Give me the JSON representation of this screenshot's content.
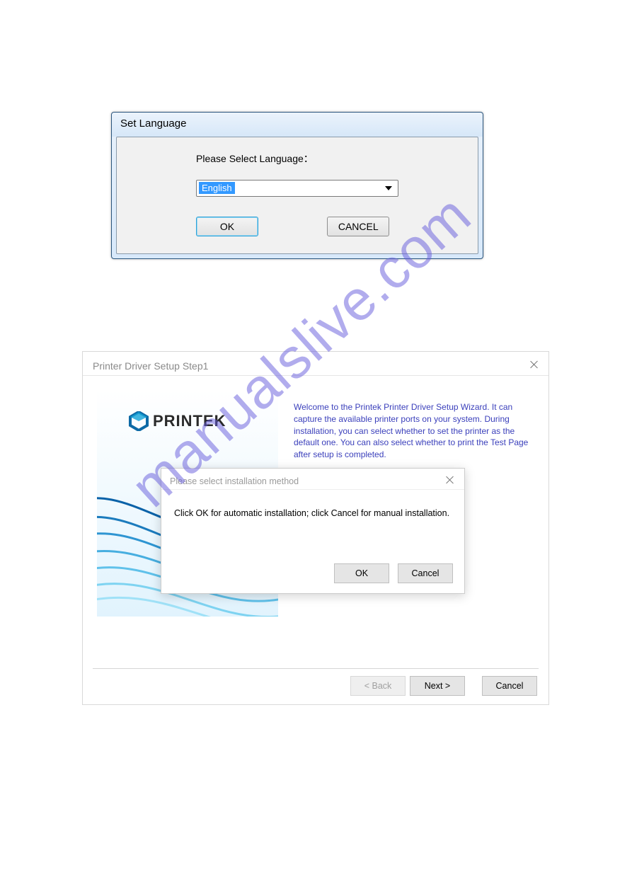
{
  "watermark": "manualslive.com",
  "dialog1": {
    "title": "Set Language",
    "label": "Please Select Language：",
    "selected": "English",
    "ok": "OK",
    "cancel": "CANCEL"
  },
  "dialog2": {
    "title": "Printer Driver Setup Step1",
    "brand": "PRINTEK",
    "welcome": "Welcome to the Printek Printer Driver Setup Wizard. It can capture the available printer ports on your system. During installation, you can select whether to set the printer as the default one. You can also select whether to print the Test Page after setup is completed.",
    "back": "< Back",
    "next": "Next >",
    "cancel": "Cancel"
  },
  "modal": {
    "title": "Please select installation method",
    "message": "Click OK for automatic installation; click Cancel for manual installation.",
    "ok": "OK",
    "cancel": "Cancel"
  }
}
